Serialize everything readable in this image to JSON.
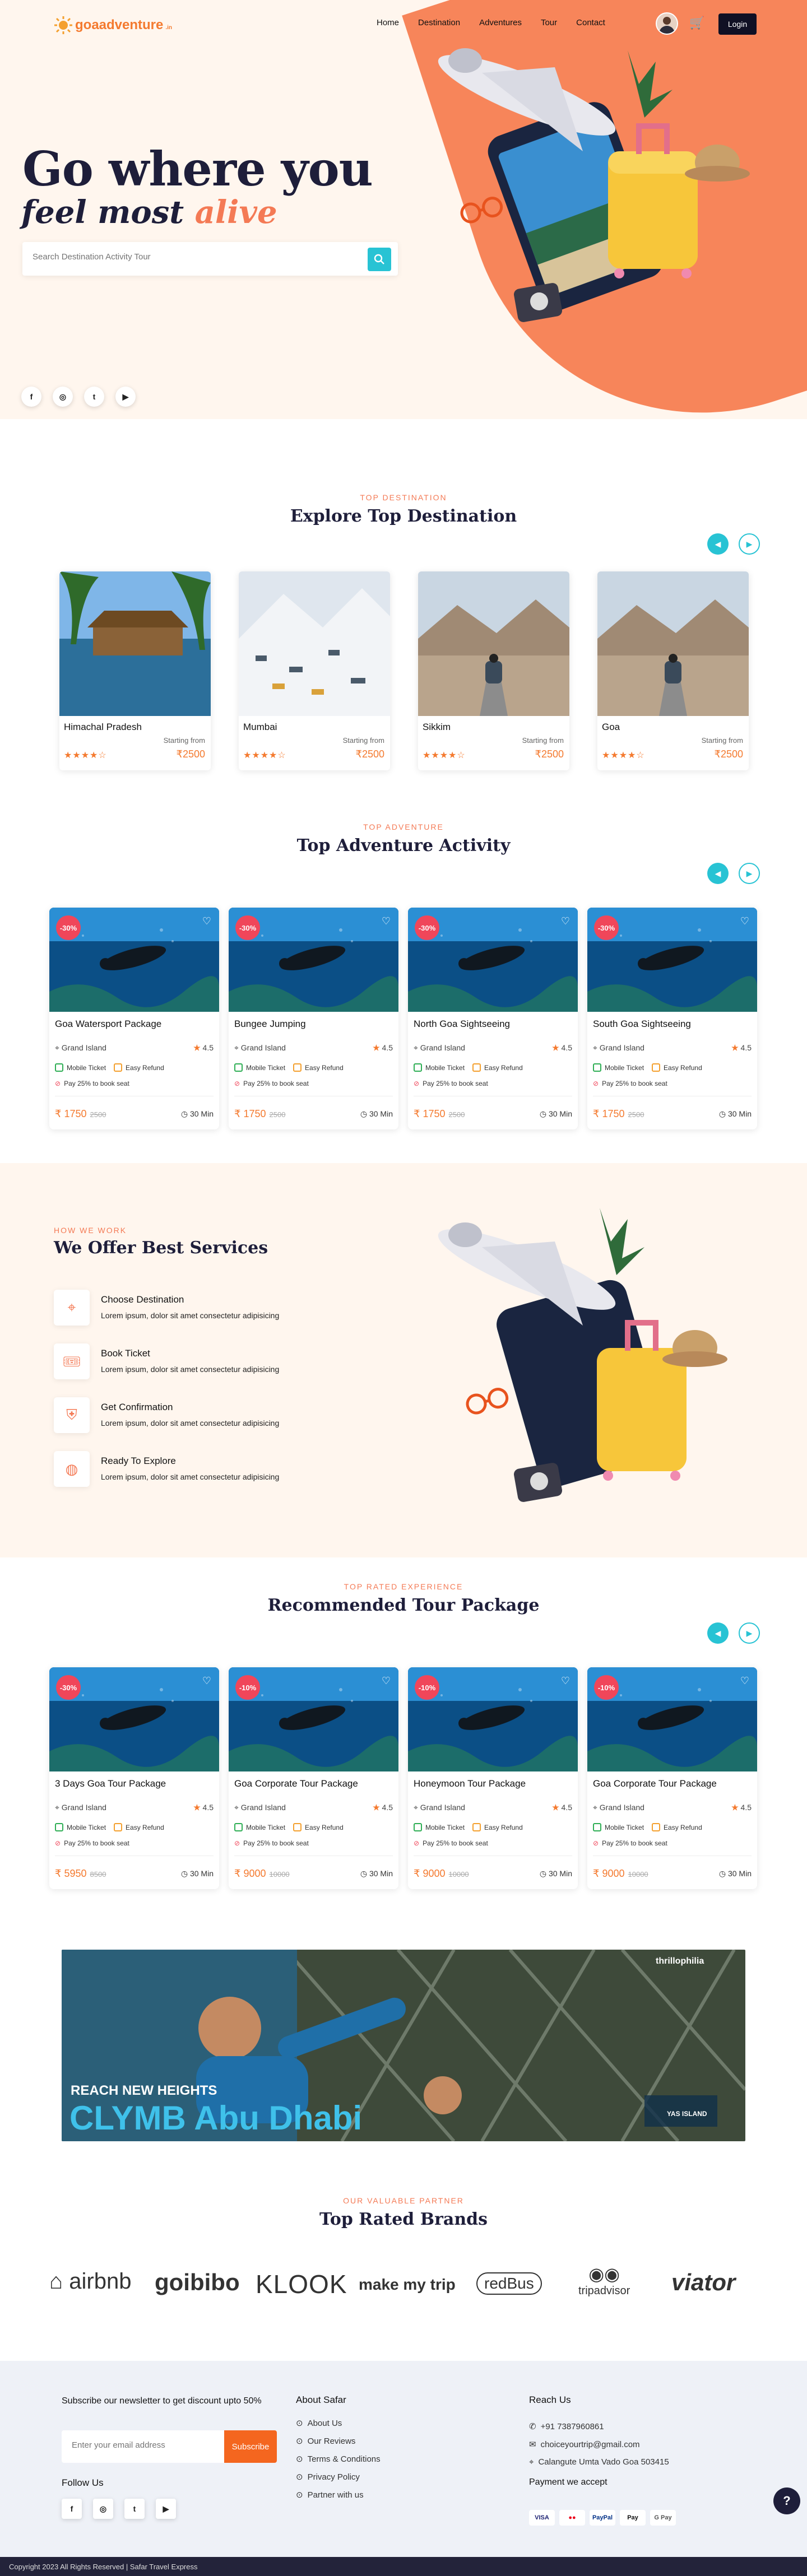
{
  "header": {
    "logo_text": "goaadventure",
    "logo_suffix": ".in",
    "nav": [
      "Home",
      "Destination",
      "Adventures",
      "Tour",
      "Contact"
    ],
    "login_label": "Login"
  },
  "hero": {
    "line1": "Go where you",
    "line2_prefix": "feel most ",
    "line2_accent": "alive",
    "search_placeholder": "Search Destination Activity Tour",
    "social": [
      "f",
      "◎",
      "t",
      "▶"
    ]
  },
  "destinations": {
    "kicker": "TOP DESTINATION",
    "title": "Explore Top Destination",
    "items": [
      {
        "name": "Himachal Pradesh",
        "from_label": "Starting from",
        "stars": "★★★★☆",
        "price": "₹2500"
      },
      {
        "name": "Mumbai",
        "from_label": "Starting from",
        "stars": "★★★★☆",
        "price": "₹2500"
      },
      {
        "name": "Sikkim",
        "from_label": "Starting from",
        "stars": "★★★★☆",
        "price": "₹2500"
      },
      {
        "name": "Goa",
        "from_label": "Starting from",
        "stars": "★★★★☆",
        "price": "₹2500"
      }
    ]
  },
  "adventures": {
    "kicker": "TOP ADVENTURE",
    "title": "Top Adventure Activity",
    "items": [
      {
        "badge": "-30%",
        "title": "Goa Watersport Package",
        "location": "Grand Island",
        "rating": "4.5",
        "f1": "Mobile Ticket",
        "f2": "Easy Refund",
        "pay": "Pay 25% to book seat",
        "price": "₹ 1750",
        "old": "2500",
        "duration": "30 Min"
      },
      {
        "badge": "-30%",
        "title": "Bungee Jumping",
        "location": "Grand Island",
        "rating": "4.5",
        "f1": "Mobile Ticket",
        "f2": "Easy Refund",
        "pay": "Pay 25% to book seat",
        "price": "₹ 1750",
        "old": "2500",
        "duration": "30 Min"
      },
      {
        "badge": "-30%",
        "title": "North Goa Sightseeing",
        "location": "Grand Island",
        "rating": "4.5",
        "f1": "Mobile Ticket",
        "f2": "Easy Refund",
        "pay": "Pay 25% to book seat",
        "price": "₹ 1750",
        "old": "2500",
        "duration": "30 Min"
      },
      {
        "badge": "-30%",
        "title": "South Goa Sightseeing",
        "location": "Grand Island",
        "rating": "4.5",
        "f1": "Mobile Ticket",
        "f2": "Easy Refund",
        "pay": "Pay 25% to book seat",
        "price": "₹ 1750",
        "old": "2500",
        "duration": "30 Min"
      }
    ]
  },
  "services": {
    "kicker": "HOW WE WORK",
    "title": "We Offer Best Services",
    "items": [
      {
        "title": "Choose Destination",
        "desc": "Lorem ipsum, dolor sit amet consectetur adipisicing"
      },
      {
        "title": "Book Ticket",
        "desc": "Lorem ipsum, dolor sit amet consectetur adipisicing"
      },
      {
        "title": "Get Confirmation",
        "desc": "Lorem ipsum, dolor sit amet consectetur adipisicing"
      },
      {
        "title": "Ready To Explore",
        "desc": "Lorem ipsum, dolor sit amet consectetur adipisicing"
      }
    ]
  },
  "tours": {
    "kicker": "TOP RATED EXPERIENCE",
    "title": "Recommended Tour Package",
    "items": [
      {
        "badge": "-30%",
        "title": "3 Days Goa Tour Package",
        "location": "Grand Island",
        "rating": "4.5",
        "f1": "Mobile Ticket",
        "f2": "Easy Refund",
        "pay": "Pay 25% to book seat",
        "price": "₹ 5950",
        "old": "8500",
        "duration": "30 Min"
      },
      {
        "badge": "-10%",
        "title": "Goa Corporate Tour Package",
        "location": "Grand Island",
        "rating": "4.5",
        "f1": "Mobile Ticket",
        "f2": "Easy Refund",
        "pay": "Pay 25% to book seat",
        "price": "₹ 9000",
        "old": "10000",
        "duration": "30 Min"
      },
      {
        "badge": "-10%",
        "title": "Honeymoon Tour Package",
        "location": "Grand Island",
        "rating": "4.5",
        "f1": "Mobile Ticket",
        "f2": "Easy Refund",
        "pay": "Pay 25% to book seat",
        "price": "₹ 9000",
        "old": "10000",
        "duration": "30 Min"
      },
      {
        "badge": "-10%",
        "title": "Goa Corporate Tour Package",
        "location": "Grand Island",
        "rating": "4.5",
        "f1": "Mobile Ticket",
        "f2": "Easy Refund",
        "pay": "Pay 25% to book seat",
        "price": "₹ 9000",
        "old": "10000",
        "duration": "30 Min"
      }
    ]
  },
  "banner": {
    "tag": "thrillophilia",
    "line1": "REACH NEW HEIGHTS",
    "line2": "CLYMB Abu Dhabi",
    "partner": "YAS ISLAND"
  },
  "brands": {
    "kicker": "OUR VALUABLE PARTNER",
    "title": "Top Rated Brands",
    "items": [
      "airbnb",
      "goibibo",
      "KLOOK",
      "make my trip",
      "redBus",
      "tripadvisor",
      "viator"
    ]
  },
  "footer": {
    "newsletter": "Subscribe our newsletter to get discount upto 50%",
    "email_placeholder": "Enter your email address",
    "subscribe_label": "Subscribe",
    "follow_label": "Follow Us",
    "about_title": "About Safar",
    "about_links": [
      "About Us",
      "Our Reviews",
      "Terms & Conditions",
      "Privacy Policy",
      "Partner with us"
    ],
    "reach_title": "Reach Us",
    "phone": "+91 7387960861",
    "email": "choiceyourtrip@gmail.com",
    "address": "Calangute Umta Vado Goa 503415",
    "payment_title": "Payment we accept",
    "payments": [
      "VISA",
      "●●",
      "PayPal",
      "Pay",
      "G Pay"
    ],
    "copyright": "Copyright 2023 All Rights Reserved | Safar Travel Express"
  },
  "colors": {
    "accent": "#f47a55",
    "teal": "#28c3d4",
    "navy": "#1e1e3a"
  }
}
